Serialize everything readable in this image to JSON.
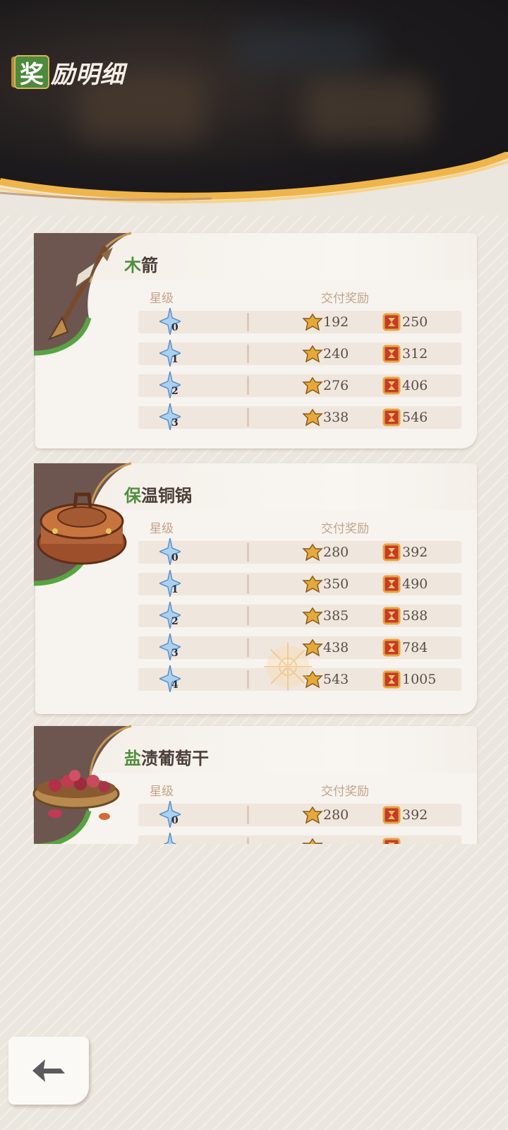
{
  "header": {
    "title_first": "奖",
    "title_rest": "励明细"
  },
  "colors": {
    "accent_green": "#4f8f3d",
    "card_bg": "#f7f3ee",
    "row_bg": "#efe6de"
  },
  "icons": {
    "star": "star-level-icon",
    "coin": "mora-coin-icon",
    "scroll": "reward-scroll-icon"
  },
  "items": [
    {
      "name_first": "木",
      "name_rest": "箭",
      "col_star": "星级",
      "col_reward": "交付奖励",
      "rows": [
        {
          "star": "0",
          "coin": "192",
          "scroll": "250"
        },
        {
          "star": "1",
          "coin": "240",
          "scroll": "312"
        },
        {
          "star": "2",
          "coin": "276",
          "scroll": "406"
        },
        {
          "star": "3",
          "coin": "338",
          "scroll": "546"
        }
      ]
    },
    {
      "name_first": "保",
      "name_rest": "温铜锅",
      "col_star": "星级",
      "col_reward": "交付奖励",
      "rows": [
        {
          "star": "0",
          "coin": "280",
          "scroll": "392"
        },
        {
          "star": "1",
          "coin": "350",
          "scroll": "490"
        },
        {
          "star": "2",
          "coin": "385",
          "scroll": "588"
        },
        {
          "star": "3",
          "coin": "438",
          "scroll": "784"
        },
        {
          "star": "4",
          "coin": "543",
          "scroll": "1005"
        }
      ]
    },
    {
      "name_first": "盐",
      "name_rest": "渍葡萄干",
      "col_star": "星级",
      "col_reward": "交付奖励",
      "rows": [
        {
          "star": "0",
          "coin": "280",
          "scroll": "392"
        }
      ]
    }
  ]
}
